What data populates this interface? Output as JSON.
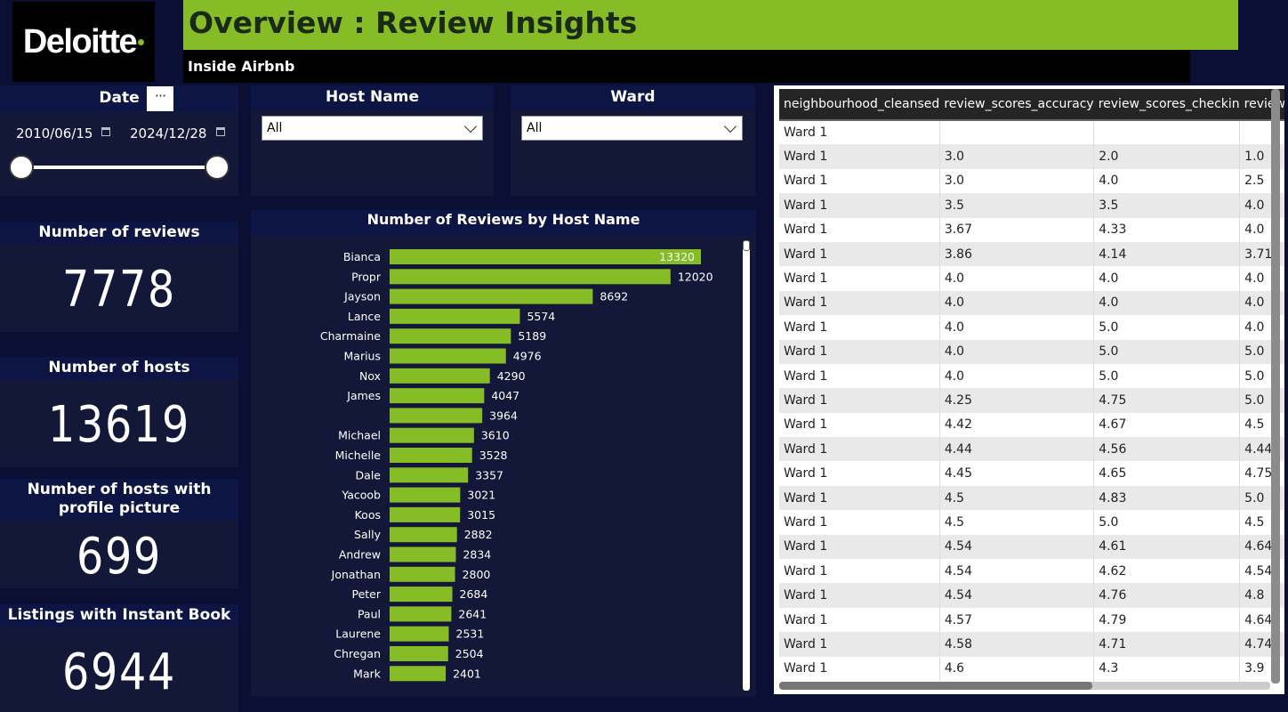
{
  "header": {
    "logo_text": "Deloitte",
    "title": "Overview : Review Insights",
    "subtitle": "Inside Airbnb"
  },
  "colors": {
    "accent": "#86bc25",
    "background": "#0a0f33",
    "panel": "#141838",
    "panel_header": "#0d1545"
  },
  "date_slicer": {
    "label": "Date",
    "start": "2010/06/15",
    "end": "2024/12/28",
    "more_label": "···"
  },
  "host_slicer": {
    "label": "Host Name",
    "value": "All"
  },
  "ward_slicer": {
    "label": "Ward",
    "value": "All"
  },
  "kpis": {
    "reviews": {
      "label": "Number of reviews",
      "value": "7778"
    },
    "hosts": {
      "label": "Number of hosts",
      "value": "13619"
    },
    "hosts_profile": {
      "label": "Number of hosts with profile picture",
      "value": "699"
    },
    "instant_book": {
      "label": "Listings with Instant Book",
      "value": "6944"
    }
  },
  "chart_data": {
    "type": "bar",
    "orientation": "horizontal",
    "title": "Number of Reviews by Host Name",
    "categories": [
      "Bianca",
      "Propr",
      "Jayson",
      "Lance",
      "Charmaine",
      "Marius",
      "Nox",
      "James",
      "",
      "Michael",
      "Michelle",
      "Dale",
      "Yacoob",
      "Koos",
      "Sally",
      "Andrew",
      "Jonathan",
      "Peter",
      "Paul",
      "Laurene",
      "Chregan",
      "Mark"
    ],
    "values": [
      13320,
      12020,
      8692,
      5574,
      5189,
      4976,
      4290,
      4047,
      3964,
      3610,
      3528,
      3357,
      3021,
      3015,
      2882,
      2834,
      2800,
      2684,
      2641,
      2531,
      2504,
      2401
    ],
    "xlim": [
      0,
      13320
    ],
    "bar_color": "#86bc25"
  },
  "table": {
    "columns": [
      "neighbourhood_cleansed",
      "review_scores_accuracy",
      "review_scores_checkin",
      "review_sc"
    ],
    "rows": [
      [
        "Ward 1",
        "",
        "",
        ""
      ],
      [
        "Ward 1",
        "3.0",
        "2.0",
        "1.0"
      ],
      [
        "Ward 1",
        "3.0",
        "4.0",
        "2.5"
      ],
      [
        "Ward 1",
        "3.5",
        "3.5",
        "4.0"
      ],
      [
        "Ward 1",
        "3.67",
        "4.33",
        "4.0"
      ],
      [
        "Ward 1",
        "3.86",
        "4.14",
        "3.71"
      ],
      [
        "Ward 1",
        "4.0",
        "4.0",
        "4.0"
      ],
      [
        "Ward 1",
        "4.0",
        "4.0",
        "4.0"
      ],
      [
        "Ward 1",
        "4.0",
        "5.0",
        "4.0"
      ],
      [
        "Ward 1",
        "4.0",
        "5.0",
        "5.0"
      ],
      [
        "Ward 1",
        "4.0",
        "5.0",
        "5.0"
      ],
      [
        "Ward 1",
        "4.25",
        "4.75",
        "5.0"
      ],
      [
        "Ward 1",
        "4.42",
        "4.67",
        "4.5"
      ],
      [
        "Ward 1",
        "4.44",
        "4.56",
        "4.44"
      ],
      [
        "Ward 1",
        "4.45",
        "4.65",
        "4.75"
      ],
      [
        "Ward 1",
        "4.5",
        "4.83",
        "5.0"
      ],
      [
        "Ward 1",
        "4.5",
        "5.0",
        "4.5"
      ],
      [
        "Ward 1",
        "4.54",
        "4.61",
        "4.64"
      ],
      [
        "Ward 1",
        "4.54",
        "4.62",
        "4.54"
      ],
      [
        "Ward 1",
        "4.54",
        "4.76",
        "4.8"
      ],
      [
        "Ward 1",
        "4.57",
        "4.79",
        "4.64"
      ],
      [
        "Ward 1",
        "4.58",
        "4.71",
        "4.74"
      ],
      [
        "Ward 1",
        "4.6",
        "4.3",
        "3.9"
      ]
    ]
  }
}
